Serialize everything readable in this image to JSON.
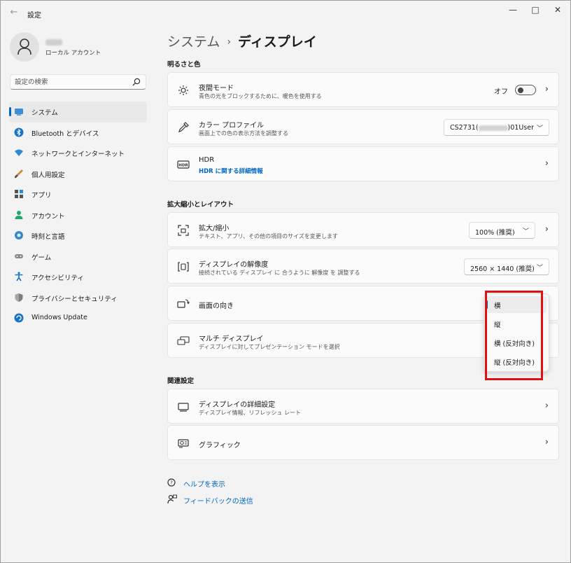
{
  "window": {
    "title": "設定",
    "back_icon": "←",
    "minimize_icon": "—",
    "maximize_icon": "□",
    "close_icon": "✕"
  },
  "user": {
    "account_type": "ローカル アカウント"
  },
  "search": {
    "placeholder": "設定の検索"
  },
  "sidebar": {
    "items": [
      {
        "label": "システム",
        "icon": "system-icon",
        "active": true
      },
      {
        "label": "Bluetooth とデバイス",
        "icon": "bluetooth-icon"
      },
      {
        "label": "ネットワークとインターネット",
        "icon": "network-icon"
      },
      {
        "label": "個人用設定",
        "icon": "brush-icon"
      },
      {
        "label": "アプリ",
        "icon": "apps-icon"
      },
      {
        "label": "アカウント",
        "icon": "account-icon"
      },
      {
        "label": "時刻と言語",
        "icon": "globe-icon"
      },
      {
        "label": "ゲーム",
        "icon": "gamepad-icon"
      },
      {
        "label": "アクセシビリティ",
        "icon": "accessibility-icon"
      },
      {
        "label": "プライバシーとセキュリティ",
        "icon": "shield-icon"
      },
      {
        "label": "Windows Update",
        "icon": "update-icon"
      }
    ]
  },
  "breadcrumb": {
    "parent": "システム",
    "separator": "›",
    "current": "ディスプレイ"
  },
  "sections": {
    "brightness": "明るさと色",
    "scale": "拡大縮小とレイアウト",
    "related": "関連設定"
  },
  "cards": {
    "night_light": {
      "title": "夜間モード",
      "desc": "青色の光をブロックするために、暖色を使用する",
      "toggle_label": "オフ"
    },
    "color_profile": {
      "title": "カラー プロファイル",
      "desc": "画面上での色の表示方法を調整する",
      "value_prefix": "CS2731(",
      "value_suffix": ")01User"
    },
    "hdr": {
      "title": "HDR",
      "link": "HDR に関する詳細情報"
    },
    "scale": {
      "title": "拡大/縮小",
      "desc": "テキスト、アプリ、その他の項目のサイズを変更します",
      "value": "100% (推奨)"
    },
    "resolution": {
      "title": "ディスプレイの解像度",
      "desc": "接続されている ディスプレイ に 合うように 解像度 を 調整する",
      "value": "2560 × 1440 (推奨)"
    },
    "orientation": {
      "title": "画面の向き"
    },
    "multi_display": {
      "title": "マルチ ディスプレイ",
      "desc": "ディスプレイに対してプレゼンテーション モードを選択"
    },
    "advanced": {
      "title": "ディスプレイの詳細設定",
      "desc": "ディスプレイ情報、リフレッシュ レート"
    },
    "graphics": {
      "title": "グラフィック"
    }
  },
  "orientation_menu": {
    "options": [
      "横",
      "縦",
      "横 (反対向き)",
      "縦 (反対向き)"
    ],
    "selected": 0
  },
  "help": {
    "get_help": "ヘルプを表示",
    "feedback": "フィードバックの送信"
  },
  "colors": {
    "accent": "#0067c0",
    "highlight": "#e01010"
  }
}
